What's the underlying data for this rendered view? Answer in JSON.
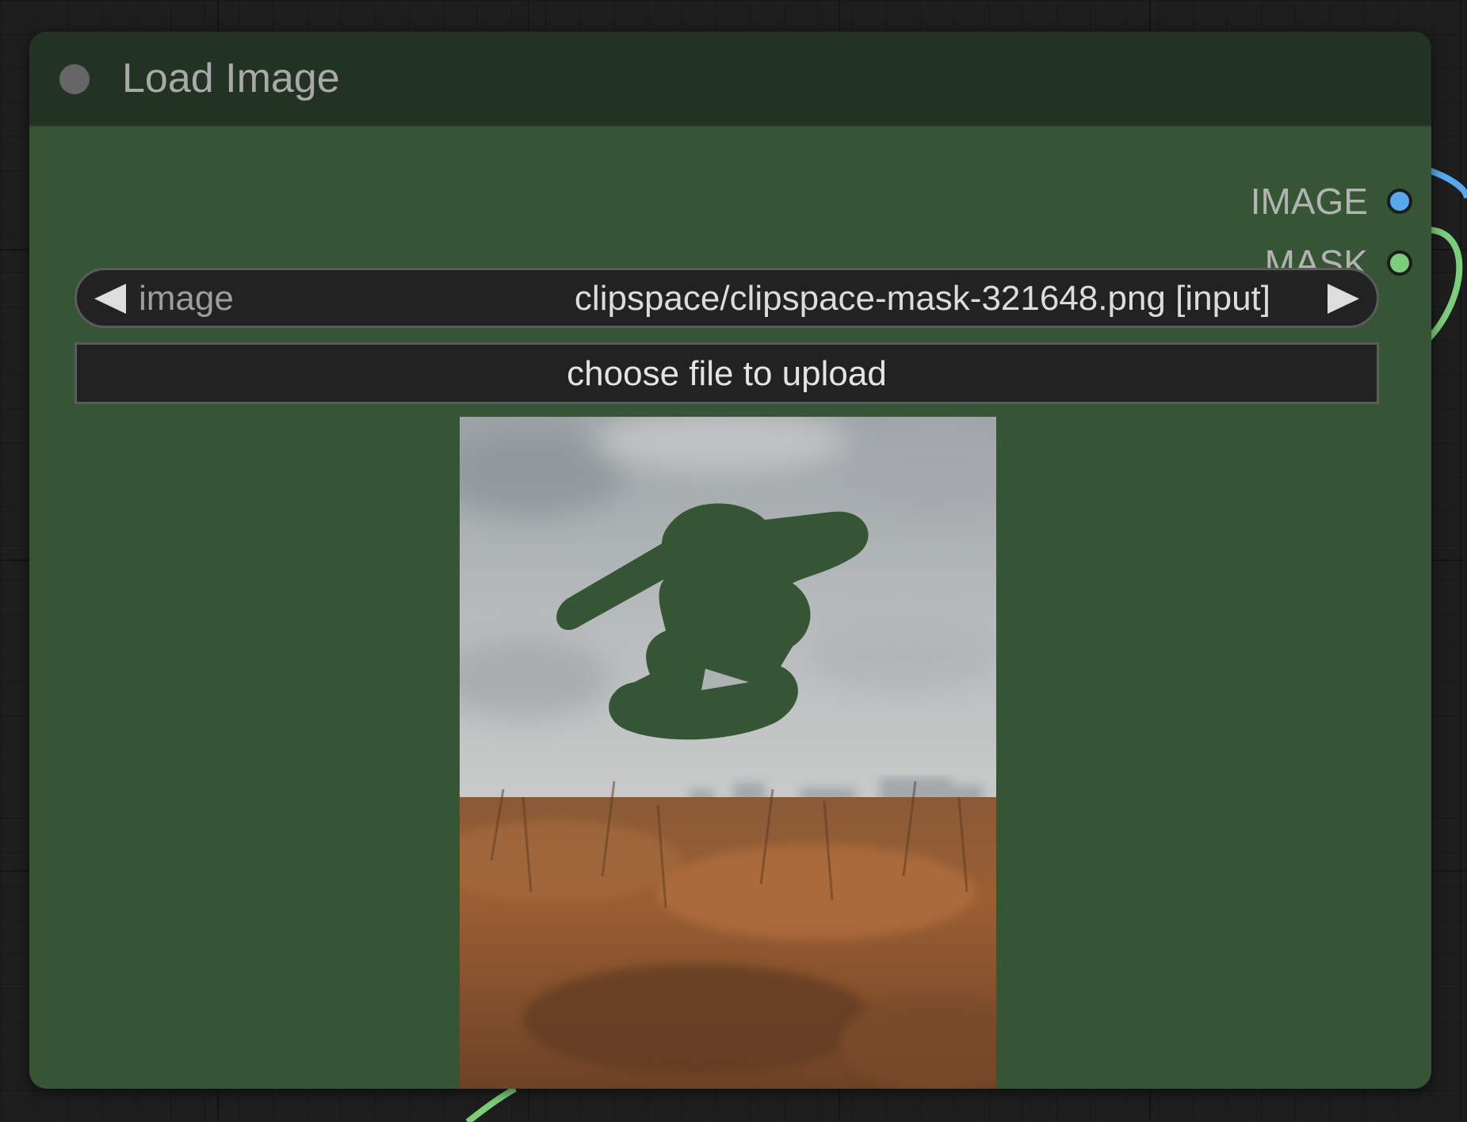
{
  "node": {
    "title": "Load Image",
    "outputs": [
      {
        "label": "IMAGE",
        "color": "#57a9ef"
      },
      {
        "label": "MASK",
        "color": "#7bcf7b"
      }
    ],
    "image_widget": {
      "label": "image",
      "value": "clipspace/clipspace-mask-321648.png [input]"
    },
    "upload_button_label": "choose file to upload"
  },
  "colors": {
    "node_body": "#355535",
    "node_header": "#233323",
    "canvas": "#1e1e1e"
  }
}
